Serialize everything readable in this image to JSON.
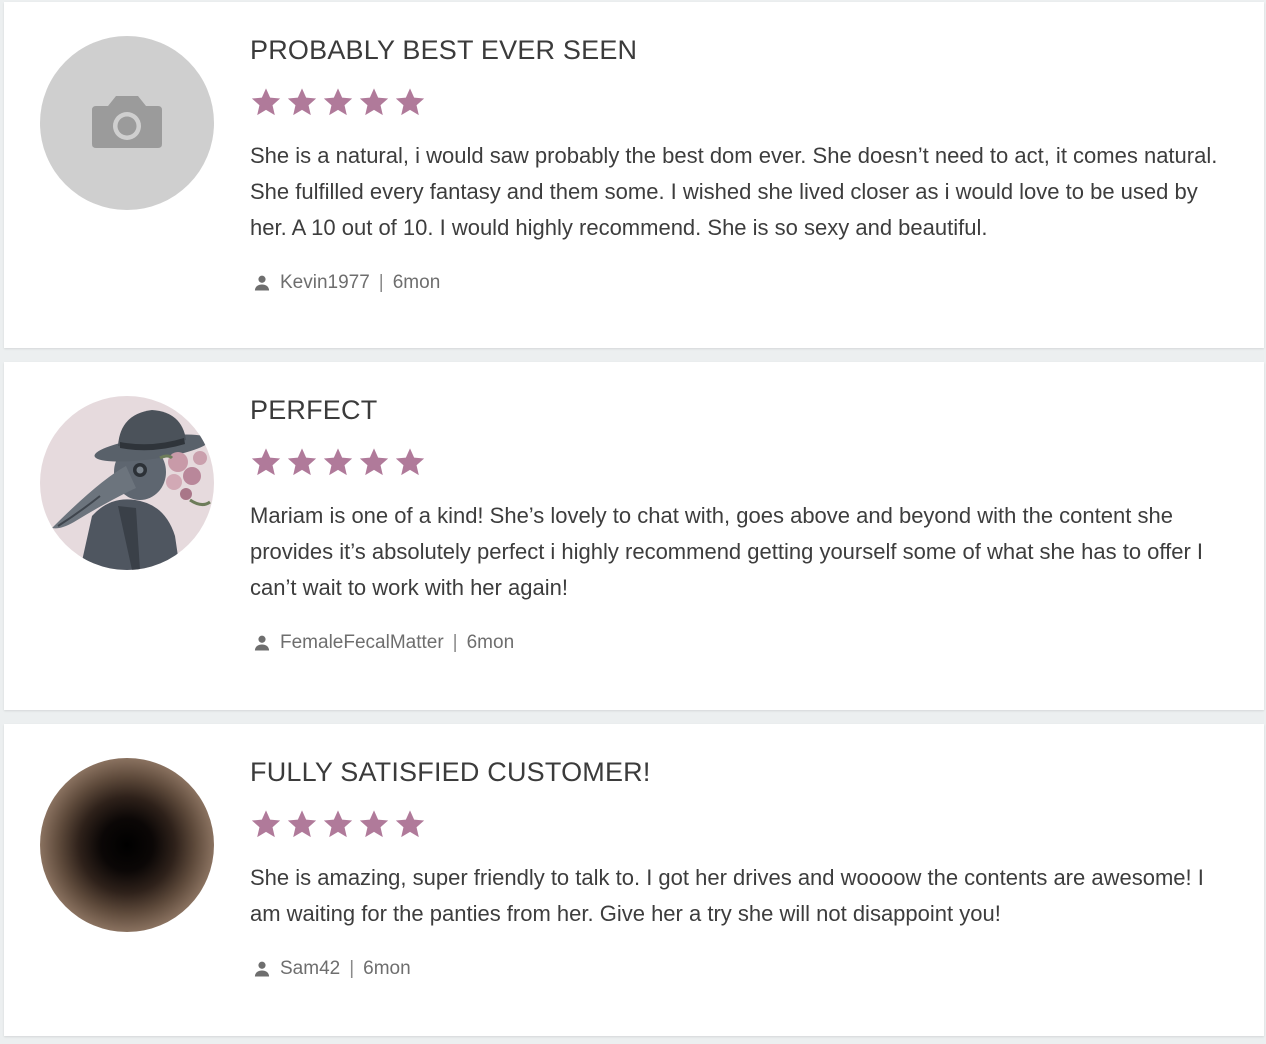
{
  "colors": {
    "star": "#b07a9a",
    "placeholder_bg": "#cfcfcf",
    "camera": "#9b9b9b"
  },
  "reviews": [
    {
      "title": "PROBABLY BEST EVER SEEN",
      "rating": 5,
      "text": "She is a natural, i would saw probably the best dom ever. She doesn’t need to act, it comes natural. She fulfilled every fantasy and them some. I wished she lived closer as i would love to be used by her. A 10 out of 10. I would highly recommend. She is so sexy and beautiful.",
      "user": "Kevin1977",
      "separator": "|",
      "time": "6mon",
      "avatar": "camera-placeholder-icon"
    },
    {
      "title": "PERFECT",
      "rating": 5,
      "text": "Mariam is one of a kind! She’s lovely to chat with, goes above and beyond with the content she provides it’s absolutely perfect i highly recommend getting yourself some of what she has to offer I can’t wait to work with her again!",
      "user": "FemaleFecalMatter",
      "separator": "|",
      "time": "6mon",
      "avatar": "plague-doctor-avatar"
    },
    {
      "title": "FULLY SATISFIED CUSTOMER!",
      "rating": 5,
      "text": "She is amazing, super friendly to talk to. I got her drives and woooow the contents are awesome! I am waiting for the panties from her. Give her a try she will not disappoint you!",
      "user": "Sam42",
      "separator": "|",
      "time": "6mon",
      "avatar": "dark-hole-avatar"
    }
  ]
}
